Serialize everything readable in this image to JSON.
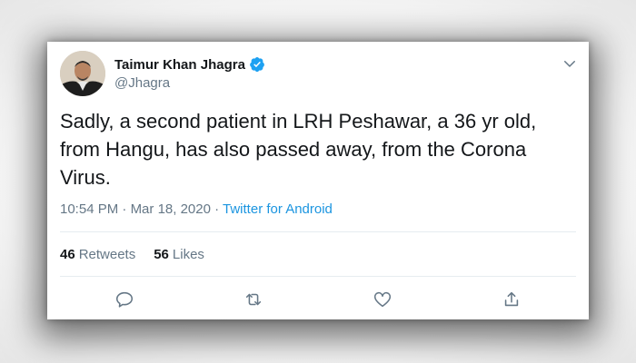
{
  "author": {
    "name": "Taimur Khan Jhagra",
    "handle": "@Jhagra",
    "verified_icon": "verified-badge-icon",
    "avatar_icon": "profile-photo"
  },
  "tweet": {
    "text": "Sadly, a second patient in LRH Peshawar, a 36 yr old,\nfrom Hangu, has also passed away, from the Corona\nVirus.",
    "time": "10:54 PM",
    "separator": " · ",
    "date": "Mar 18, 2020",
    "source": "Twitter for Android"
  },
  "stats": {
    "retweets_count": "46",
    "retweets_label": "Retweets",
    "likes_count": "56",
    "likes_label": "Likes"
  },
  "actions": [
    "reply-icon",
    "retweet-icon",
    "like-icon",
    "share-icon"
  ],
  "colors": {
    "accent": "#1b95e0",
    "text": "#14171a",
    "muted": "#657786",
    "verified": "#1da1f2"
  }
}
